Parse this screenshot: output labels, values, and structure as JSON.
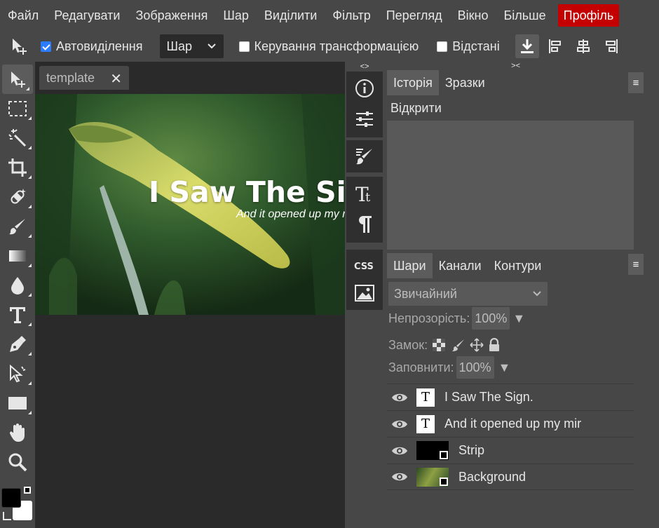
{
  "menu": {
    "items": [
      "Файл",
      "Редагувати",
      "Зображення",
      "Шар",
      "Виділити",
      "Фільтр",
      "Перегляд",
      "Вікно",
      "Більше"
    ],
    "profile": "Профіль"
  },
  "options": {
    "auto_select_label": "Автовиділення",
    "auto_select_checked": true,
    "layer_select_value": "Шар",
    "transform_label": "Керування трансформацією",
    "distances_label": "Відстані"
  },
  "document": {
    "tab_title": "template",
    "headline": "I Saw The Sign.",
    "subline": "And it opened up my mind"
  },
  "iconcol": {
    "grip_left": "<>",
    "grip_right": "><"
  },
  "history_panel": {
    "tabs": [
      "Історія",
      "Зразки"
    ],
    "active_tab": 0,
    "entries": [
      "Відкрити"
    ]
  },
  "layers_panel": {
    "tabs": [
      "Шари",
      "Канали",
      "Контури"
    ],
    "active_tab": 0,
    "blend_mode": "Звичайний",
    "opacity_label": "Непрозорість:",
    "opacity_value": "100%",
    "lock_label": "Замок:",
    "fill_label": "Заповнити:",
    "fill_value": "100%",
    "layers": [
      {
        "name": "I Saw The Sign.",
        "type": "text"
      },
      {
        "name": "And it opened up my mir",
        "type": "text"
      },
      {
        "name": "Strip",
        "type": "raster"
      },
      {
        "name": "Background",
        "type": "image"
      }
    ]
  },
  "colors": {
    "accent_red": "#c40000",
    "panel_bg": "#474747",
    "workspace_bg": "#2a2a2a",
    "foreground_color": "#000000",
    "background_color": "#ffffff"
  }
}
